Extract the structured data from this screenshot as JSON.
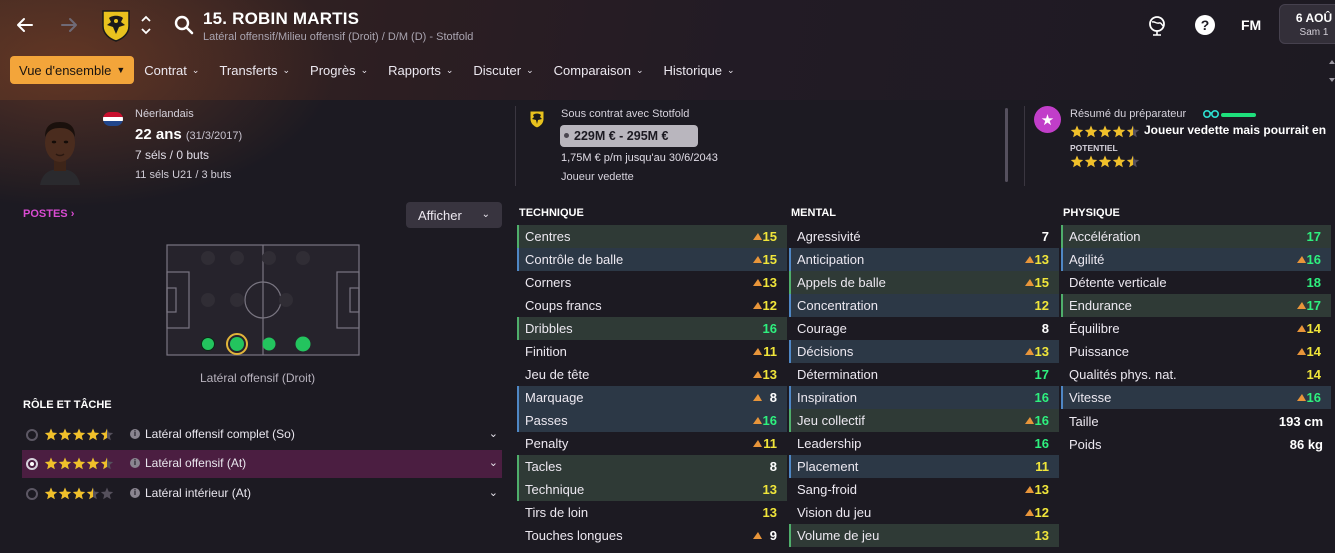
{
  "header": {
    "player_title": "15. ROBIN MARTIS",
    "player_subtitle": "Latéral offensif/Milieu offensif (Droit) / D/M (D) - Stotfold",
    "fm_label": "FM",
    "date_line1": "6 AOÛ",
    "date_line2": "Sam 1"
  },
  "menu": [
    {
      "label": "Vue d'ensemble",
      "active": true
    },
    {
      "label": "Contrat",
      "active": false
    },
    {
      "label": "Transferts",
      "active": false
    },
    {
      "label": "Progrès",
      "active": false
    },
    {
      "label": "Rapports",
      "active": false
    },
    {
      "label": "Discuter",
      "active": false
    },
    {
      "label": "Comparaison",
      "active": false
    },
    {
      "label": "Historique",
      "active": false
    }
  ],
  "profile": {
    "nationality": "Néerlandais",
    "age": "22 ans",
    "dob": "(31/3/2017)",
    "caps": "7 séls / 0 buts",
    "u21": "11 séls U21 / 3 buts"
  },
  "contract": {
    "club_line": "Sous contrat avec Stotfold",
    "value_range": "229M € - 295M €",
    "wage": "1,75M € p/m jusqu'au 30/6/2043",
    "status": "Joueur vedette"
  },
  "coach": {
    "title": "Résumé du préparateur",
    "current_stars": 4.5,
    "note": "Joueur vedette mais pourrait en",
    "potential_label": "POTENTIEL",
    "potential_stars": 4.5
  },
  "positions": {
    "link": "POSTES",
    "show_button": "Afficher",
    "caption": "Latéral offensif (Droit)"
  },
  "roles": {
    "title": "RÔLE ET TÂCHE",
    "items": [
      {
        "stars": 4.5,
        "name": "Latéral offensif complet (So)",
        "selected": false
      },
      {
        "stars": 4.5,
        "name": "Latéral offensif (At)",
        "selected": true
      },
      {
        "stars": 3.5,
        "name": "Latéral intérieur (At)",
        "selected": false
      }
    ]
  },
  "attributes": {
    "technique": {
      "title": "TECHNIQUE",
      "rows": [
        {
          "name": "Centres",
          "value": 15,
          "hl": "g",
          "arrow": true
        },
        {
          "name": "Contrôle de balle",
          "value": 15,
          "hl": "b",
          "arrow": true
        },
        {
          "name": "Corners",
          "value": 13,
          "hl": "",
          "arrow": true
        },
        {
          "name": "Coups francs",
          "value": 12,
          "hl": "",
          "arrow": true
        },
        {
          "name": "Dribbles",
          "value": 16,
          "hl": "g",
          "arrow": false
        },
        {
          "name": "Finition",
          "value": 11,
          "hl": "",
          "arrow": true
        },
        {
          "name": "Jeu de tête",
          "value": 13,
          "hl": "",
          "arrow": true
        },
        {
          "name": "Marquage",
          "value": 8,
          "hl": "b",
          "arrow": true
        },
        {
          "name": "Passes",
          "value": 16,
          "hl": "b",
          "arrow": true
        },
        {
          "name": "Penalty",
          "value": 11,
          "hl": "",
          "arrow": true
        },
        {
          "name": "Tacles",
          "value": 8,
          "hl": "g",
          "arrow": false
        },
        {
          "name": "Technique",
          "value": 13,
          "hl": "g",
          "arrow": false
        },
        {
          "name": "Tirs de loin",
          "value": 13,
          "hl": "",
          "arrow": false
        },
        {
          "name": "Touches longues",
          "value": 9,
          "hl": "",
          "arrow": true
        }
      ]
    },
    "mental": {
      "title": "MENTAL",
      "rows": [
        {
          "name": "Agressivité",
          "value": 7,
          "hl": "",
          "arrow": false
        },
        {
          "name": "Anticipation",
          "value": 13,
          "hl": "b",
          "arrow": true
        },
        {
          "name": "Appels de balle",
          "value": 15,
          "hl": "g",
          "arrow": true
        },
        {
          "name": "Concentration",
          "value": 12,
          "hl": "b",
          "arrow": false
        },
        {
          "name": "Courage",
          "value": 8,
          "hl": "",
          "arrow": false
        },
        {
          "name": "Décisions",
          "value": 13,
          "hl": "b",
          "arrow": true
        },
        {
          "name": "Détermination",
          "value": 17,
          "hl": "",
          "arrow": false
        },
        {
          "name": "Inspiration",
          "value": 16,
          "hl": "b",
          "arrow": false
        },
        {
          "name": "Jeu collectif",
          "value": 16,
          "hl": "g",
          "arrow": true
        },
        {
          "name": "Leadership",
          "value": 16,
          "hl": "",
          "arrow": false
        },
        {
          "name": "Placement",
          "value": 11,
          "hl": "b",
          "arrow": false
        },
        {
          "name": "Sang-froid",
          "value": 13,
          "hl": "",
          "arrow": true
        },
        {
          "name": "Vision du jeu",
          "value": 12,
          "hl": "",
          "arrow": true
        },
        {
          "name": "Volume de jeu",
          "value": 13,
          "hl": "g",
          "arrow": false
        }
      ]
    },
    "physique": {
      "title": "PHYSIQUE",
      "rows": [
        {
          "name": "Accélération",
          "value": 17,
          "hl": "g",
          "arrow": false
        },
        {
          "name": "Agilité",
          "value": 16,
          "hl": "b",
          "arrow": true
        },
        {
          "name": "Détente verticale",
          "value": 18,
          "hl": "",
          "arrow": false
        },
        {
          "name": "Endurance",
          "value": 17,
          "hl": "g",
          "arrow": true
        },
        {
          "name": "Équilibre",
          "value": 14,
          "hl": "",
          "arrow": true
        },
        {
          "name": "Puissance",
          "value": 14,
          "hl": "",
          "arrow": true
        },
        {
          "name": "Qualités phys. nat.",
          "value": 14,
          "hl": "",
          "arrow": false
        },
        {
          "name": "Vitesse",
          "value": 16,
          "hl": "b",
          "arrow": true
        }
      ],
      "height_label": "Taille",
      "height_value": "193 cm",
      "weight_label": "Poids",
      "weight_value": "86 kg"
    }
  },
  "colors": {
    "accent": "#f3a53a",
    "value_high": "#2ef07e",
    "value_mid": "#f0e53a",
    "value_low": "#ffffff",
    "highlight_green": "#2f3a36",
    "highlight_blue": "#2c3846",
    "selected_role": "#4b1e41"
  },
  "icons": [
    "back-arrow-icon",
    "forward-arrow-icon",
    "club-crest-icon",
    "up-down-chevron-icon",
    "search-icon",
    "world-globe-icon",
    "help-icon",
    "star-badge-icon",
    "binoculars-icon",
    "info-icon",
    "chevron-down-icon"
  ]
}
